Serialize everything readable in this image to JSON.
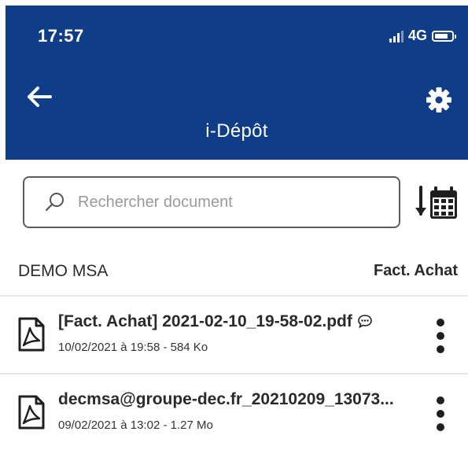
{
  "status_bar": {
    "time": "17:57",
    "network": "4G"
  },
  "header": {
    "title": "i-Dépôt",
    "back_icon": "arrow-left-icon",
    "settings_icon": "gear-icon"
  },
  "search": {
    "placeholder": "Rechercher document",
    "value": ""
  },
  "section": {
    "company": "DEMO MSA",
    "category": "Fact. Achat"
  },
  "documents": [
    {
      "name": "[Fact. Achat] 2021-02-10_19-58-02.pdf",
      "meta": "10/02/2021 à 19:58 - 584 Ko",
      "has_comment": true
    },
    {
      "name": "decmsa@groupe-dec.fr_20210209_13073...",
      "meta": "09/02/2021 à 13:02 - 1.27 Mo",
      "has_comment": false
    }
  ],
  "colors": {
    "header_bg": "#0f3d87",
    "text": "#2a2a2a",
    "border": "#5c5c5c"
  }
}
